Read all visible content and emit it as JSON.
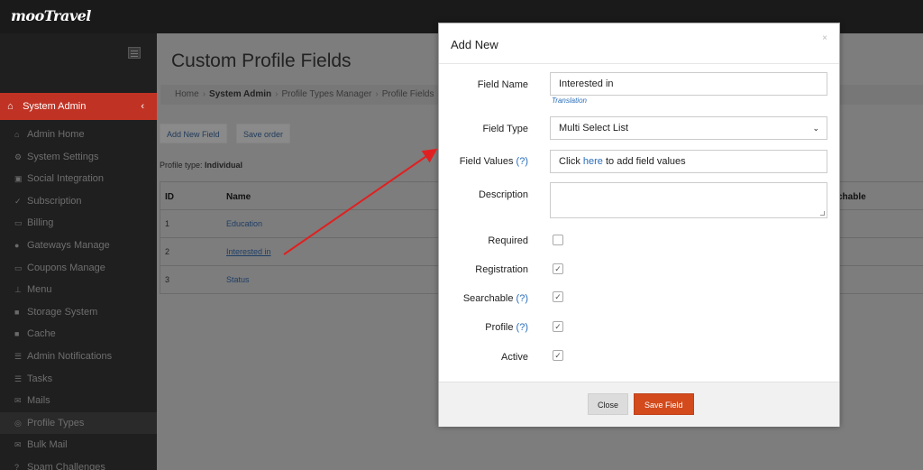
{
  "app": {
    "logo": "mooTravel"
  },
  "sidebar": {
    "section": {
      "label": "System Admin",
      "icon": "home-icon"
    },
    "items": [
      {
        "label": "Admin Home",
        "icon": "home-icon"
      },
      {
        "label": "System Settings",
        "icon": "gear-icon"
      },
      {
        "label": "Social Integration",
        "icon": "square-icon"
      },
      {
        "label": "Subscription",
        "icon": "check-icon"
      },
      {
        "label": "Billing",
        "icon": "card-icon"
      },
      {
        "label": "Gateways Manage",
        "icon": "plug-icon"
      },
      {
        "label": "Coupons Manage",
        "icon": "ticket-icon"
      },
      {
        "label": "Menu",
        "icon": "sitemap-icon"
      },
      {
        "label": "Storage System",
        "icon": "file-icon"
      },
      {
        "label": "Cache",
        "icon": "file-icon"
      },
      {
        "label": "Admin Notifications",
        "icon": "list-icon"
      },
      {
        "label": "Tasks",
        "icon": "list-icon"
      },
      {
        "label": "Mails",
        "icon": "mail-icon"
      },
      {
        "label": "Profile Types",
        "icon": "check-circle-icon",
        "active": true
      },
      {
        "label": "Bulk Mail",
        "icon": "mail-icon"
      },
      {
        "label": "Spam Challenges",
        "icon": "question-circle-icon"
      }
    ]
  },
  "main": {
    "title": "Custom Profile Fields",
    "breadcrumb": [
      "Home",
      "System Admin",
      "Profile Types Manager",
      "Profile Fields"
    ],
    "buttons": {
      "add_new_field": "Add New Field",
      "save_order": "Save order"
    },
    "profile_type_label": "Profile type:",
    "profile_type_value": "Individual",
    "table": {
      "headers": {
        "id": "ID",
        "name": "Name",
        "searchable": "chable"
      },
      "rows": [
        {
          "id": "1",
          "name": "Education"
        },
        {
          "id": "2",
          "name": "Interested in"
        },
        {
          "id": "3",
          "name": "Status"
        }
      ]
    }
  },
  "modal": {
    "title": "Add New",
    "close_symbol": "×",
    "fields": {
      "field_name": {
        "label": "Field Name",
        "value": "Interested in",
        "translation_link": "Translation"
      },
      "field_type": {
        "label": "Field Type",
        "value": "Multi Select List"
      },
      "field_values": {
        "label": "Field Values",
        "help": "(?)",
        "text_before": "Click",
        "link": "here",
        "text_after": "to add field values"
      },
      "description": {
        "label": "Description",
        "value": ""
      },
      "required": {
        "label": "Required",
        "checked": false
      },
      "registration": {
        "label": "Registration",
        "checked": true
      },
      "searchable": {
        "label": "Searchable",
        "help": "(?)",
        "checked": true
      },
      "profile": {
        "label": "Profile",
        "help": "(?)",
        "checked": true
      },
      "active": {
        "label": "Active",
        "checked": true
      }
    },
    "footer": {
      "close_label": "Close",
      "save_label": "Save Field"
    }
  },
  "colors": {
    "accent_red": "#c03324",
    "save_button": "#d34a1c",
    "link_blue": "#2a6ebb",
    "annotation_arrow": "#e02020"
  },
  "glyphs": {
    "check": "✓",
    "caret": "⌄",
    "chev_left": "‹",
    "sep": "›"
  }
}
